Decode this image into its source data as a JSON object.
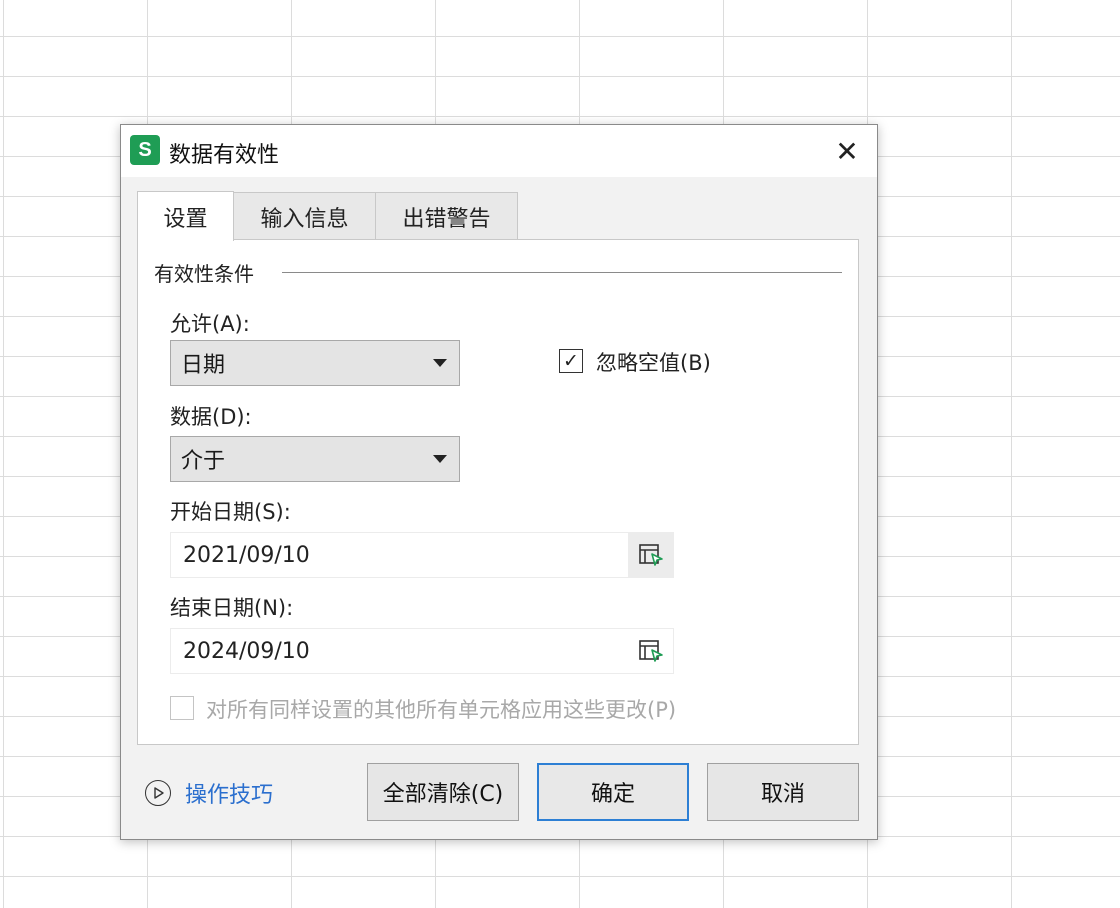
{
  "dialog": {
    "icon_letter": "S",
    "title": "数据有效性",
    "close_symbol": "✕"
  },
  "tabs": [
    {
      "label": "设置",
      "active": true
    },
    {
      "label": "输入信息",
      "active": false
    },
    {
      "label": "出错警告",
      "active": false
    }
  ],
  "settings": {
    "section_title": "有效性条件",
    "allow_label": "允许(A):",
    "allow_value": "日期",
    "ignore_blank_label": "忽略空值(B)",
    "ignore_blank_checked": true,
    "data_label": "数据(D):",
    "data_value": "介于",
    "start_label": "开始日期(S):",
    "start_value": "2021/09/10",
    "end_label": "结束日期(N):",
    "end_value": "2024/09/10",
    "apply_all_label": "对所有同样设置的其他所有单元格应用这些更改(P)",
    "apply_all_checked": false,
    "check_mark": "✓"
  },
  "footer": {
    "tips_label": "操作技巧",
    "clear_label": "全部清除(C)",
    "ok_label": "确定",
    "cancel_label": "取消"
  },
  "colors": {
    "app_icon": "#1f9d55",
    "link": "#2b6fce",
    "primary_border": "#2d7fd4",
    "picker_accent": "#1f9d55"
  },
  "icons": {
    "app": "spreadsheet-app-icon",
    "close": "close-icon",
    "dropdown": "dropdown-arrow-icon",
    "picker": "range-picker-icon",
    "tips": "play-circle-icon"
  }
}
